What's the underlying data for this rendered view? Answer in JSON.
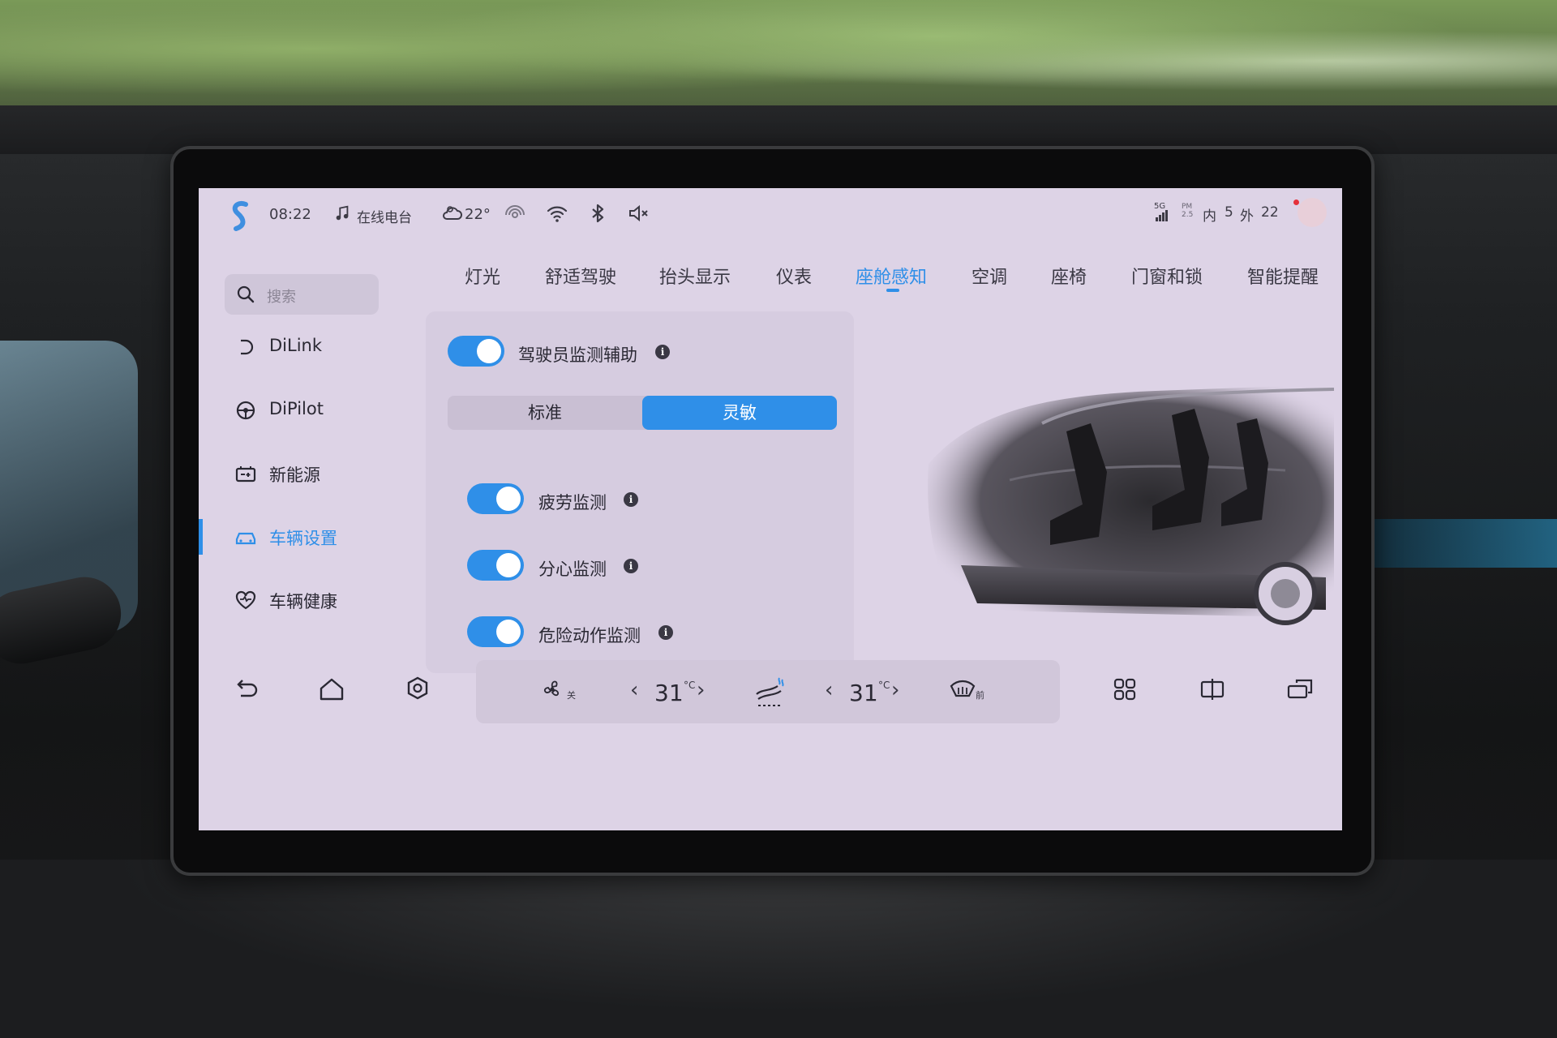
{
  "status_bar": {
    "time": "08:22",
    "music_label": "在线电台",
    "weather_temp": "22°",
    "cabin_label": "内",
    "cabin_value": "5",
    "outside_label": "外",
    "outside_value": "22",
    "signal_label": "5G",
    "pm_label": "PM 2.5"
  },
  "sidebar": {
    "search_placeholder": "搜索",
    "items": [
      {
        "label": "DiLink"
      },
      {
        "label": "DiPilot"
      },
      {
        "label": "新能源"
      },
      {
        "label": "车辆设置"
      },
      {
        "label": "车辆健康"
      }
    ],
    "active_index": 3
  },
  "tabs": [
    {
      "label": "灯光"
    },
    {
      "label": "舒适驾驶"
    },
    {
      "label": "抬头显示"
    },
    {
      "label": "仪表"
    },
    {
      "label": "座舱感知"
    },
    {
      "label": "空调"
    },
    {
      "label": "座椅"
    },
    {
      "label": "门窗和锁"
    },
    {
      "label": "智能提醒"
    }
  ],
  "active_tab": 4,
  "panel": {
    "main_toggle_label": "驾驶员监测辅助",
    "main_toggle_on": true,
    "mode_standard": "标准",
    "mode_sensitive": "灵敏",
    "selected_mode": "灵敏",
    "sub_toggles": [
      {
        "label": "疲劳监测",
        "on": true
      },
      {
        "label": "分心监测",
        "on": true
      },
      {
        "label": "危险动作监测",
        "on": true
      }
    ]
  },
  "dock": {
    "fan_label": "关",
    "left_temp": "31",
    "right_temp": "31",
    "temp_unit": "°C",
    "defrost_label": "前"
  },
  "colors": {
    "accent": "#2f8fe8",
    "screen_bg": "#ddd3e6",
    "panel_bg": "#d6cce0"
  }
}
